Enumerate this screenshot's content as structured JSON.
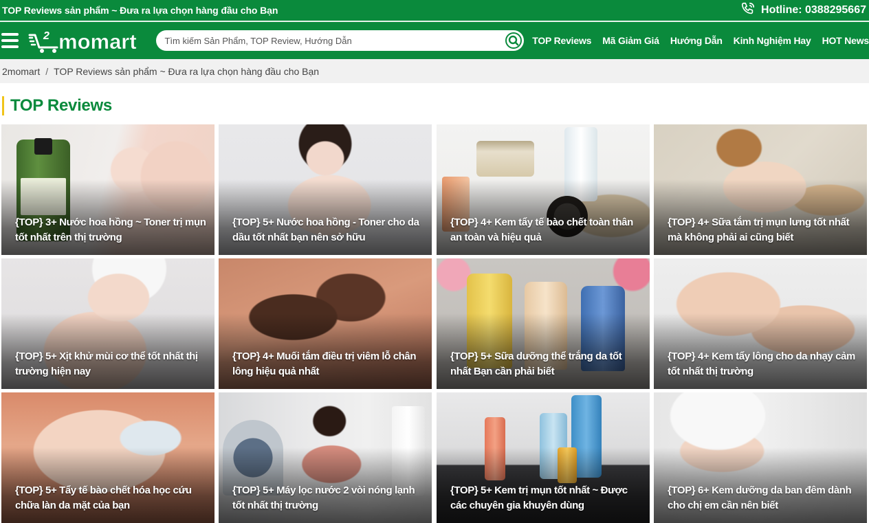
{
  "topbar": {
    "slogan": "TOP Reviews sản phẩm ~ Đưa ra lựa chọn hàng đầu cho Bạn",
    "hotline": "Hotline: 0388295667",
    "hotline_icon": "phone-icon"
  },
  "header": {
    "logo_text": "momart",
    "logo_superscript": "2",
    "search_placeholder": "Tìm kiếm Sản Phẩm, TOP Review, Hướng Dẫn",
    "nav": [
      "TOP Reviews",
      "Mã Giảm Giá",
      "Hướng Dẫn",
      "Kinh Nghiệm Hay",
      "HOT News"
    ]
  },
  "breadcrumb": {
    "home": "2momart",
    "separator": "/",
    "current": "TOP Reviews sản phẩm ~ Đưa ra lựa chọn hàng đầu cho Bạn"
  },
  "section": {
    "title": "TOP Reviews"
  },
  "colors": {
    "brand_green": "#0a8a3c",
    "accent_yellow": "#f0c419",
    "breadcrumb_bg": "#f1f1f1"
  },
  "articles": [
    {
      "title": "{TOP} 3+ Nước hoa hồng ~ Toner trị mụn tốt nhất trên thị trường"
    },
    {
      "title": "{TOP} 5+ Nước hoa hồng - Toner cho da dầu tốt nhất bạn nên sở hữu"
    },
    {
      "title": "{TOP} 4+ Kem tẩy tế bào chết toàn thân an toàn và hiệu quả"
    },
    {
      "title": "{TOP} 4+ Sữa tắm trị mụn lưng tốt nhất mà không phải ai cũng biết"
    },
    {
      "title": "{TOP} 5+ Xịt khử mùi cơ thể tốt nhất thị trường hiện nay"
    },
    {
      "title": "{TOP} 4+ Muối tắm điều trị viêm lỗ chân lông hiệu quả nhất"
    },
    {
      "title": "{TOP} 5+ Sữa dưỡng thể trắng da tốt nhất Bạn cần phải biết"
    },
    {
      "title": "{TOP} 4+ Kem tẩy lông cho da nhạy cảm tốt nhất thị trường"
    },
    {
      "title": "{TOP} 5+ Tẩy tế bào chết hóa học cứu chữa làn da mặt của bạn"
    },
    {
      "title": "{TOP} 5+ Máy lọc nước 2 vòi nóng lạnh tốt nhất thị trường"
    },
    {
      "title": "{TOP} 5+ Kem trị mụn tốt nhất ~ Được các chuyên gia khuyên dùng"
    },
    {
      "title": "{TOP} 6+ Kem dưỡng da ban đêm dành cho chị em cần nên biết"
    }
  ]
}
